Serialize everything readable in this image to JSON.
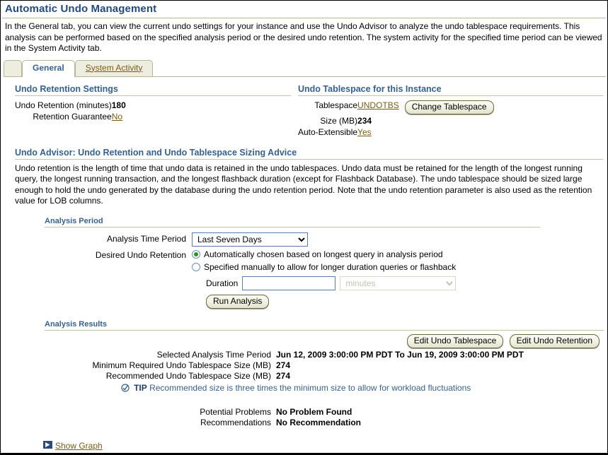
{
  "page": {
    "title": "Automatic Undo Management",
    "intro": "In the General tab, you can view the current undo settings for your instance and use the Undo Advisor to analyze the undo tablespace requirements. This analysis can be performed based on the specified analysis period or the desired undo retention. The system activity for the specified time period can be viewed in the System Activity tab."
  },
  "tabs": [
    {
      "label": "General",
      "selected": true
    },
    {
      "label": "System Activity",
      "selected": false
    }
  ],
  "undo_retention_settings": {
    "heading": "Undo Retention Settings",
    "rows": [
      {
        "label": "Undo Retention (minutes)",
        "value": "180",
        "type": "text"
      },
      {
        "label": "Retention Guarantee",
        "value": "No",
        "type": "link"
      }
    ]
  },
  "undo_tablespace": {
    "heading": "Undo Tablespace for this Instance",
    "rows": [
      {
        "label": "Tablespace",
        "value": "UNDOTBS",
        "type": "link"
      },
      {
        "label": "Size (MB)",
        "value": "234",
        "type": "text"
      },
      {
        "label": "Auto-Extensible",
        "value": "Yes",
        "type": "link"
      }
    ],
    "change_tablespace_button": "Change Tablespace"
  },
  "advisor": {
    "heading": "Undo Advisor: Undo Retention and Undo Tablespace Sizing Advice",
    "description": "Undo retention is the length of time that undo data is retained in the undo tablespaces. Undo data must be retained for the length of the longest running query, the longest running transaction, and the longest flashback duration (except for Flashback Database). The undo tablespace should be sized large enough to hold the undo generated by the database during the undo retention period. Note that the undo retention parameter is also used as the retention value for LOB columns."
  },
  "analysis_period": {
    "heading": "Analysis Period",
    "time_period_label": "Analysis Time Period",
    "time_period_value": "Last Seven Days",
    "time_period_options": [
      "Last Seven Days"
    ],
    "desired_undo_retention_label": "Desired Undo Retention",
    "radio_auto_label": "Automatically chosen based on longest query in analysis period",
    "radio_manual_label": "Specified manually to allow for longer duration queries or flashback",
    "duration_label": "Duration",
    "duration_value": "",
    "duration_units_value": "minutes",
    "duration_units_options": [
      "minutes"
    ],
    "run_analysis_button": "Run Analysis"
  },
  "analysis_results": {
    "heading": "Analysis Results",
    "edit_undo_tablespace_button": "Edit Undo Tablespace",
    "edit_undo_retention_button": "Edit Undo Retention",
    "rows": [
      {
        "label": "Selected Analysis Time Period",
        "value": "Jun 12, 2009 3:00:00 PM PDT To Jun 19, 2009 3:00:00 PM PDT"
      },
      {
        "label": "Minimum Required Undo Tablespace Size (MB)",
        "value": "274"
      },
      {
        "label": "Recommended Undo Tablespace Size (MB)",
        "value": "274"
      }
    ],
    "tip_word": "TIP",
    "tip_text": "Recommended size is three times the minimum size to allow for workload fluctuations",
    "problem_rows": [
      {
        "label": "Potential Problems",
        "value": "No Problem Found"
      },
      {
        "label": "Recommendations",
        "value": "No Recommendation"
      }
    ]
  },
  "show_graph": {
    "label": "Show Graph"
  },
  "colors": {
    "heading_blue": "#36618f",
    "title_blue": "#234a80",
    "link_brown": "#7a5c14",
    "rule_olive": "#b7b79c",
    "tab_bg": "#eeeee0",
    "button_border": "#6b6b3f",
    "radio_green": "#1f9a1f",
    "tip_blue": "#36618f"
  }
}
